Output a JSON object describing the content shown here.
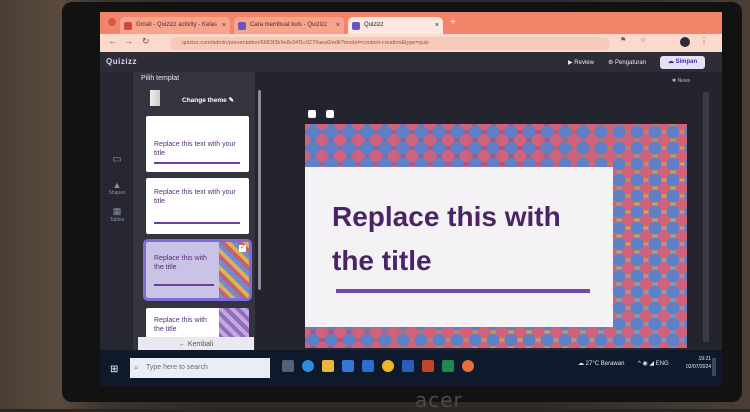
{
  "browser": {
    "tabs": [
      {
        "label": "Gmail - Quizizz activity - Kelas"
      },
      {
        "label": "Cara membuat kuis - Quizizz"
      },
      {
        "label": "Quizizz"
      }
    ],
    "new_tab_icon": "plus-icon",
    "url": "quizizz.com/admin/presentation/6683f3b9e8c04f1c0279aea0/edit?model=content-creation&type=quiz"
  },
  "app": {
    "brand": "Quizizz",
    "review_label": "Review",
    "settings_label": "Pengaturan",
    "save_label": "Simpan",
    "news_label": "News",
    "sidebar": {
      "title": "Pilih templat",
      "change_theme": "Change theme",
      "back": "Kembali"
    },
    "rail": [
      {
        "label": "",
        "icon": "slides-icon"
      },
      {
        "label": "Shapes",
        "icon": "shapes-icon"
      },
      {
        "label": "Tables",
        "icon": "table-icon"
      }
    ],
    "templates": [
      {
        "title": "Replace this text with your title"
      },
      {
        "title": "Replace this text with your title"
      },
      {
        "title": "Replace this with the title"
      },
      {
        "title": "Replace this with the title"
      }
    ],
    "slide": {
      "title": "Replace this with the title"
    }
  },
  "taskbar": {
    "search_placeholder": "Type here to search",
    "weather": "27°C Berawan",
    "lang": "ENG",
    "time": "19:21",
    "date": "02/07/2024"
  },
  "hardware": {
    "brand": "acer"
  },
  "colors": {
    "accent": "#7747a8",
    "tabbar": "#f2846a",
    "taskbar": "#0e1a2b"
  }
}
